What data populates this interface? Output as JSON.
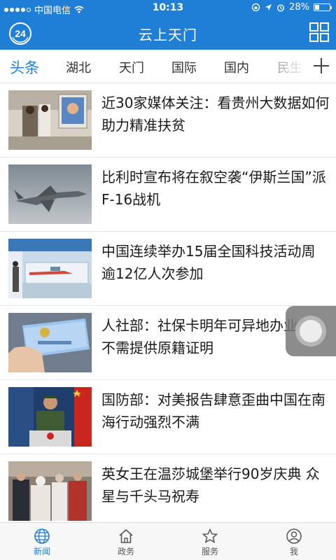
{
  "status": {
    "carrier": "中国电信",
    "time": "10:13",
    "battery": "28%",
    "battery_level": 0.28
  },
  "header": {
    "logo_text": "24",
    "title": "云上天门"
  },
  "tabs": [
    {
      "label": "头条",
      "active": true
    },
    {
      "label": "湖北"
    },
    {
      "label": "天门"
    },
    {
      "label": "国际"
    },
    {
      "label": "国内"
    },
    {
      "label": "民生"
    }
  ],
  "news": [
    {
      "title": "近30家媒体关注：看贵州大数据如何助力精准扶贫"
    },
    {
      "title": "比利时宣布将在叙空袭“伊斯兰国”派F-16战机"
    },
    {
      "title": "中国连续举办15届全国科技活动周 逾12亿人次参加"
    },
    {
      "title": "人社部：社保卡明年可异地办业务 不需提供原籍证明"
    },
    {
      "title": "国防部：对美报告肆意歪曲中国在南海行动强烈不满"
    },
    {
      "title": "英女王在温莎城堡举行90岁庆典 众星与千头马祝寿"
    }
  ],
  "bottom_nav": [
    {
      "label": "新闻",
      "icon": "globe-icon",
      "active": true
    },
    {
      "label": "政务",
      "icon": "home-icon"
    },
    {
      "label": "服务",
      "icon": "star-icon"
    },
    {
      "label": "我",
      "icon": "user-icon"
    }
  ],
  "colors": {
    "brand": "#1f7fd6",
    "text": "#1a1a1a"
  }
}
